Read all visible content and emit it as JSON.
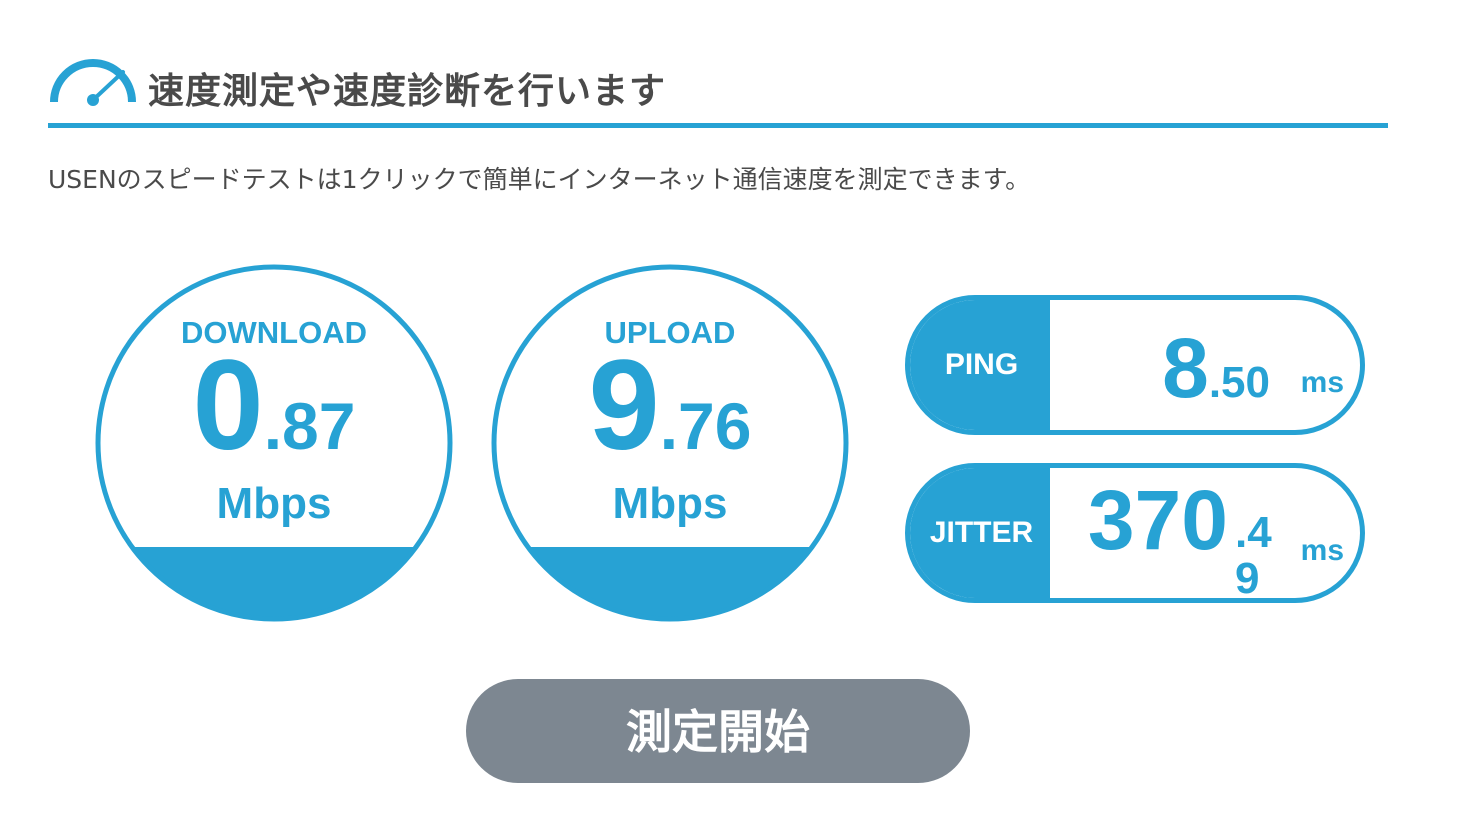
{
  "heading": {
    "icon": "speedometer-icon",
    "title": "速度測定や速度診断を行います"
  },
  "description": "USENのスピードテストは1クリックで簡単にインターネット通信速度を測定できます。",
  "download": {
    "label": "DOWNLOAD",
    "value_int": "0",
    "value_dec": ".87",
    "unit": "Mbps"
  },
  "upload": {
    "label": "UPLOAD",
    "value_int": "9",
    "value_dec": ".76",
    "unit": "Mbps"
  },
  "ping": {
    "label": "PING",
    "value_int": "8",
    "value_dec": ".50",
    "unit": "ms"
  },
  "jitter": {
    "label": "JITTER",
    "value_int": "370",
    "value_dec": ".49",
    "unit": "ms"
  },
  "start_button": {
    "label": "測定開始"
  },
  "colors": {
    "accent": "#27a2d4",
    "button": "#7d8791",
    "text": "#4a4a4a"
  }
}
